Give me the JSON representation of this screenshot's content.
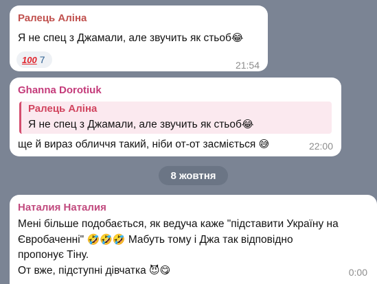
{
  "messages": [
    {
      "sender": "Ралець Аліна",
      "text": "Я не спец з Джамали, але звучить як стьоб",
      "emoji": "😂",
      "reaction": {
        "icon": "100",
        "count": "7"
      },
      "time": "21:54"
    },
    {
      "sender": "Ghanna Dorotiuk",
      "quote": {
        "sender": "Ралець Аліна",
        "text": "Я не спец з Джамали, але звучить як стьоб",
        "emoji": "😂"
      },
      "text": "ще й вираз обличчя такий, ніби от-от засміється",
      "emoji": "😅",
      "time": "22:00"
    },
    {
      "sender": "Наталия Наталия",
      "line1": "Мені більше подобається, як ведуча каже \"підставити Україну на",
      "line2a": "Євробаченні\"",
      "emojis_mid": "🤣🤣🤣",
      "line2b": " Мабуть тому і Джа так відповідно",
      "line3": "пропонує Тіну.",
      "line4": "От вже, підступні дівчатка",
      "emojis_end": "😈😋",
      "time": "0:00"
    }
  ],
  "date_separator": "8 жовтня",
  "colors": {
    "background": "#7b8494",
    "sender1": "#c0504d",
    "sender2": "#c43b7a",
    "sender3": "#c14a7e",
    "quote_bar": "#d44d6e"
  }
}
